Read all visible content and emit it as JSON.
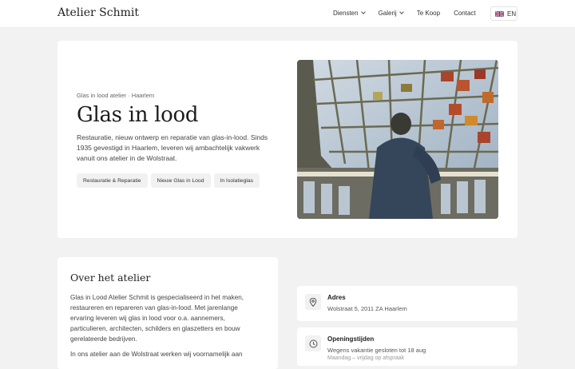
{
  "header": {
    "brand": "Atelier Schmit",
    "nav": [
      {
        "label": "Diensten",
        "dropdown": true
      },
      {
        "label": "Galerij",
        "dropdown": true
      },
      {
        "label": "Te Koop",
        "dropdown": false
      },
      {
        "label": "Contact",
        "dropdown": false
      }
    ],
    "language": {
      "code": "EN",
      "flag_icon": "uk-flag-icon"
    }
  },
  "hero": {
    "eyebrow": "Glas in lood atelier · Haarlem",
    "title": "Glas in lood",
    "description": "Restauratie, nieuw ontwerp en reparatie van glas-in-lood. Sinds 1935 gevestigd in Haarlem, leveren wij ambachtelijk vakwerk vanuit ons atelier in de Wolstraat.",
    "chips": [
      "Restauratie & Reparatie",
      "Nieuw Glas in Lood",
      "In Isolatieglas"
    ],
    "image_icon": "stained-glass-ceiling-photo"
  },
  "about": {
    "heading": "Over het atelier",
    "paragraph1": "Glas in Lood Atelier Schmit is gespecialiseerd in het maken, restaureren en repareren van glas-in-lood. Met jarenlange ervaring leveren wij glas in lood voor o.a. aannemers, particulieren, architecten, schilders en glaszetters en bouw gerelateerde bedrijven.",
    "paragraph2": "In ons atelier aan de Wolstraat werken wij voornamelijk aan"
  },
  "info": {
    "address": {
      "title": "Adres",
      "text": "Wolstraat 5, 2011 ZA Haarlem",
      "icon": "location-pin-icon"
    },
    "hours": {
      "title": "Openingstijden",
      "text": "Wegens vakantie gesloten tot 18 aug",
      "sub": "Maandag – vrijdag op afspraak",
      "icon": "clock-icon"
    }
  },
  "colors": {
    "page_bg": "#f2f2f2",
    "card_bg": "#ffffff",
    "chip_bg": "#f1f1f1",
    "text": "#222222"
  }
}
